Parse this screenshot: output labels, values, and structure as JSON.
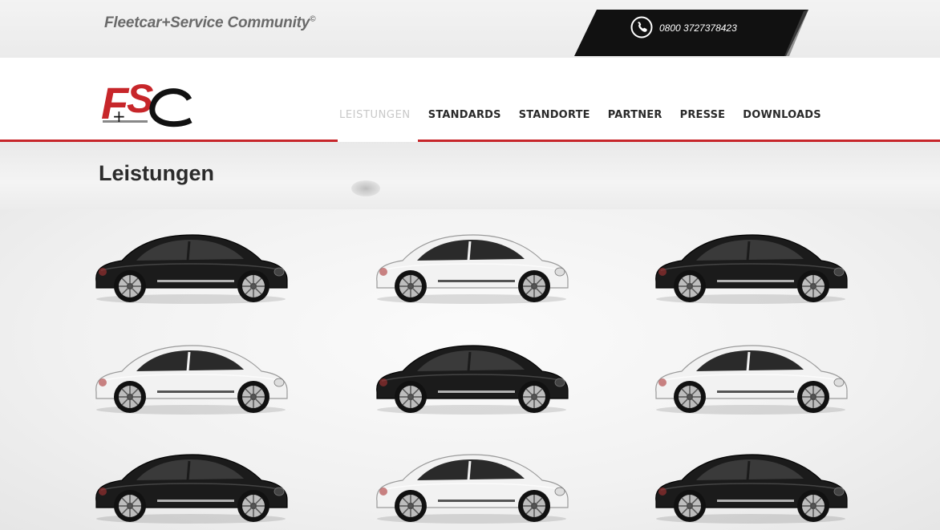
{
  "topbar": {
    "community_label": "Fleetcar+Service Community",
    "registered_mark": "©",
    "phone_number": "0800 3727378423"
  },
  "logo": {
    "text": "FSC",
    "plus": "+"
  },
  "nav": {
    "items": [
      {
        "label": "LEISTUNGEN",
        "active": true
      },
      {
        "label": "STANDARDS",
        "active": false
      },
      {
        "label": "STANDORTE",
        "active": false
      },
      {
        "label": "PARTNER",
        "active": false
      },
      {
        "label": "PRESSE",
        "active": false
      },
      {
        "label": "DOWNLOADS",
        "active": false
      }
    ]
  },
  "page": {
    "title": "Leistungen"
  },
  "colors": {
    "accent": "#c7262a",
    "dark": "#1a1a1a"
  },
  "gallery": {
    "cars": [
      {
        "name": "car-1",
        "body": "black"
      },
      {
        "name": "car-2",
        "body": "white"
      },
      {
        "name": "car-3",
        "body": "black"
      },
      {
        "name": "car-4",
        "body": "white"
      },
      {
        "name": "car-5",
        "body": "black"
      },
      {
        "name": "car-6",
        "body": "white"
      },
      {
        "name": "car-7",
        "body": "black"
      },
      {
        "name": "car-8",
        "body": "white"
      },
      {
        "name": "car-9",
        "body": "black"
      }
    ]
  }
}
